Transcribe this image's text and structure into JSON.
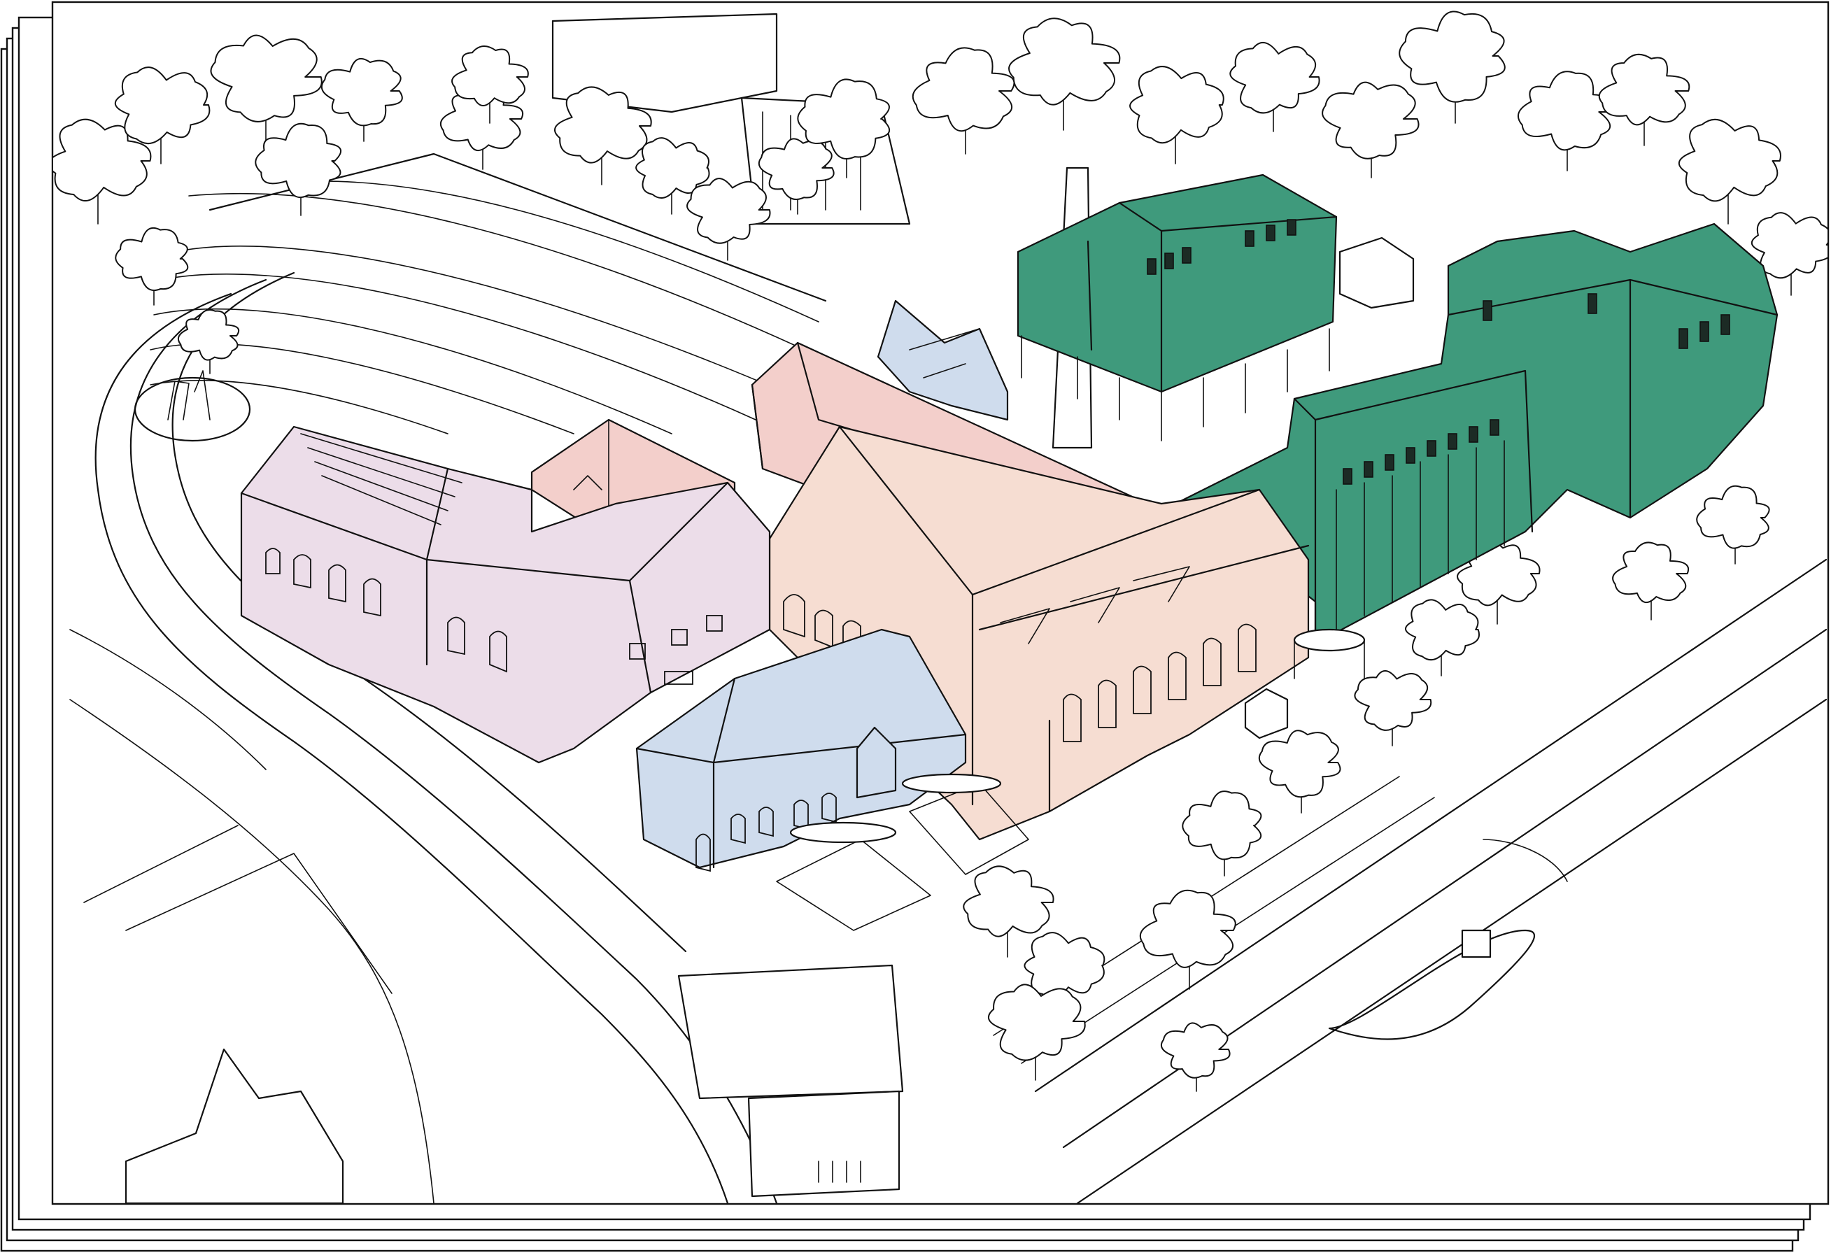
{
  "drawing": {
    "style": "hand-drawn axonometric site sketch",
    "stacked_sheet_count": 5,
    "colors": {
      "green": "#3f9a7c",
      "pink": "#f3cfcb",
      "salmon": "#f6ddd2",
      "lilac": "#ecdde9",
      "blue": "#cfdced",
      "ink": "#111111",
      "paper": "#ffffff"
    },
    "building_groups": [
      {
        "id": "green-mill-north",
        "color": "green"
      },
      {
        "id": "green-mill-east",
        "color": "green"
      },
      {
        "id": "pink-long-hall",
        "color": "pink"
      },
      {
        "id": "salmon-central-hall",
        "color": "salmon"
      },
      {
        "id": "lilac-west-terrace",
        "color": "lilac"
      },
      {
        "id": "blue-south-block",
        "color": "blue"
      },
      {
        "id": "blue-rear-house",
        "color": "blue"
      }
    ]
  }
}
